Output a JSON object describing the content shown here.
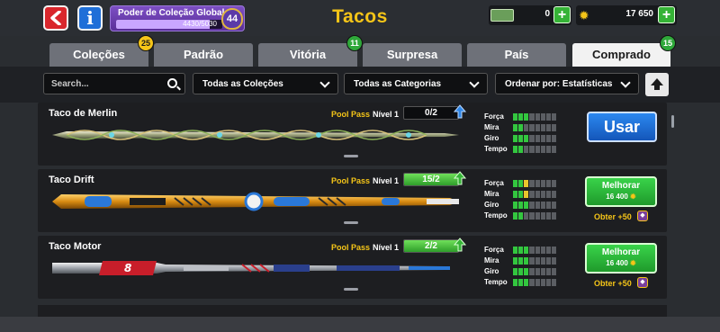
{
  "header": {
    "title": "Tacos",
    "info_label": "i",
    "power": {
      "label": "Poder de Coleção Global",
      "value": "4430/5030",
      "progress": 0.88,
      "level": "44"
    },
    "cash": {
      "value": "0",
      "plus": "+"
    },
    "coins": {
      "value": "17 650",
      "plus": "+"
    }
  },
  "tabs": [
    {
      "label": "Coleções",
      "badge": "25",
      "badge_color": "yellow"
    },
    {
      "label": "Padrão",
      "badge": ""
    },
    {
      "label": "Vitória",
      "badge": "11",
      "badge_color": "green"
    },
    {
      "label": "Surpresa",
      "badge": ""
    },
    {
      "label": "País",
      "badge": ""
    },
    {
      "label": "Comprado",
      "badge": "15",
      "badge_color": "green",
      "active": true
    }
  ],
  "filters": {
    "search_placeholder": "Search...",
    "collections": "Todas as Coleções",
    "categories": "Todas as Categorias",
    "sort": "Ordenar por: Estatísticas"
  },
  "stat_labels": [
    "Força",
    "Mira",
    "Giro",
    "Tempo"
  ],
  "cues": [
    {
      "name": "Taco de Merlin",
      "pool_pass": "Pool Pass",
      "level_label": "Nível 1",
      "level_progress": "0/2",
      "level_fraction": 0.0,
      "level_arrow": "blue",
      "stats": [
        3,
        2,
        3,
        2
      ],
      "action": "Usar"
    },
    {
      "name": "Taco Drift",
      "pool_pass": "Pool Pass",
      "level_label": "Nível 1",
      "level_progress": "15/2",
      "level_fraction": 1.0,
      "level_arrow": "green",
      "stats": [
        2,
        2,
        3,
        2
      ],
      "stat_upgrades": [
        1,
        1,
        0,
        0
      ],
      "action": "Melhorar",
      "cost": "16 400",
      "obter": "Obter +50"
    },
    {
      "name": "Taco Motor",
      "pool_pass": "Pool Pass",
      "level_label": "Nível 1",
      "level_progress": "2/2",
      "level_fraction": 1.0,
      "level_arrow": "green",
      "stats": [
        3,
        3,
        3,
        3
      ],
      "action": "Melhorar",
      "cost": "16 400",
      "obter": "Obter +50"
    }
  ],
  "colors": {
    "accent_yellow": "#f5c518",
    "usar_blue": "#1f6fd8",
    "upgrade_green": "#2fa83a",
    "back_red": "#d9262c"
  }
}
